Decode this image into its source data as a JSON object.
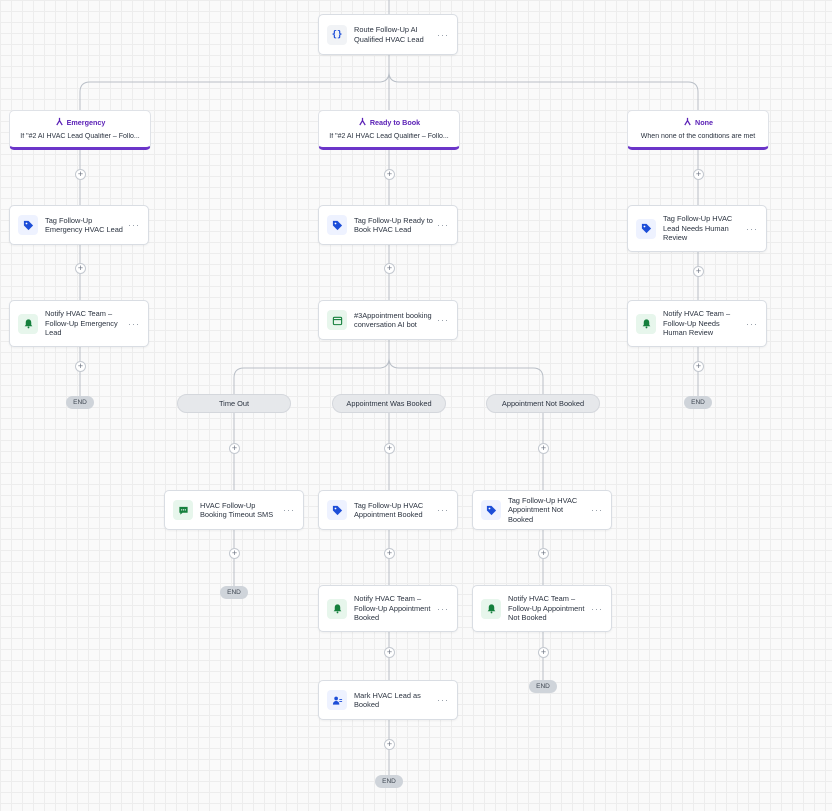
{
  "route_node": {
    "label": "Route Follow-Up AI Qualified HVAC Lead",
    "icon": "code-braces-icon"
  },
  "branches": {
    "emergency": {
      "title": "Emergency",
      "desc": "If \"#2 AI HVAC Lead Qualifier – Follo..."
    },
    "ready": {
      "title": "Ready to Book",
      "desc": "If \"#2 AI HVAC Lead Qualifier – Follo..."
    },
    "none": {
      "title": "None",
      "desc": "When none of the conditions are met"
    }
  },
  "actions": {
    "tag_emergency": "Tag Follow-Up Emergency HVAC Lead",
    "notify_emergency": "Notify HVAC Team – Follow-Up Emergency Lead",
    "tag_ready": "Tag Follow-Up Ready to Book HVAC Lead",
    "appt_bot": "#3Appointment booking conversation AI bot",
    "tag_review": "Tag Follow-Up HVAC Lead Needs Human Review",
    "notify_review": "Notify HVAC Team – Follow-Up Needs Human Review",
    "timeout_sms": "HVAC Follow-Up Booking Timeout SMS",
    "tag_booked": "Tag Follow-Up HVAC Appointment Booked",
    "notify_booked": "Notify HVAC Team – Follow-Up Appointment Booked",
    "mark_booked": "Mark HVAC Lead as Booked",
    "tag_not_booked": "Tag Follow-Up HVAC Appointment Not Booked",
    "notify_not_booked": "Notify HVAC Team – Follow-Up Appointment Not Booked"
  },
  "outcomes": {
    "timeout": "Time Out",
    "booked": "Appointment Was Booked",
    "not_booked": "Appointment Not Booked"
  },
  "end_label": "END",
  "more_label": "···",
  "plus_label": "+",
  "colors": {
    "branch_accent": "#6b35c9",
    "tag_icon": "#1d4ed8",
    "notify_icon": "#15803d"
  }
}
